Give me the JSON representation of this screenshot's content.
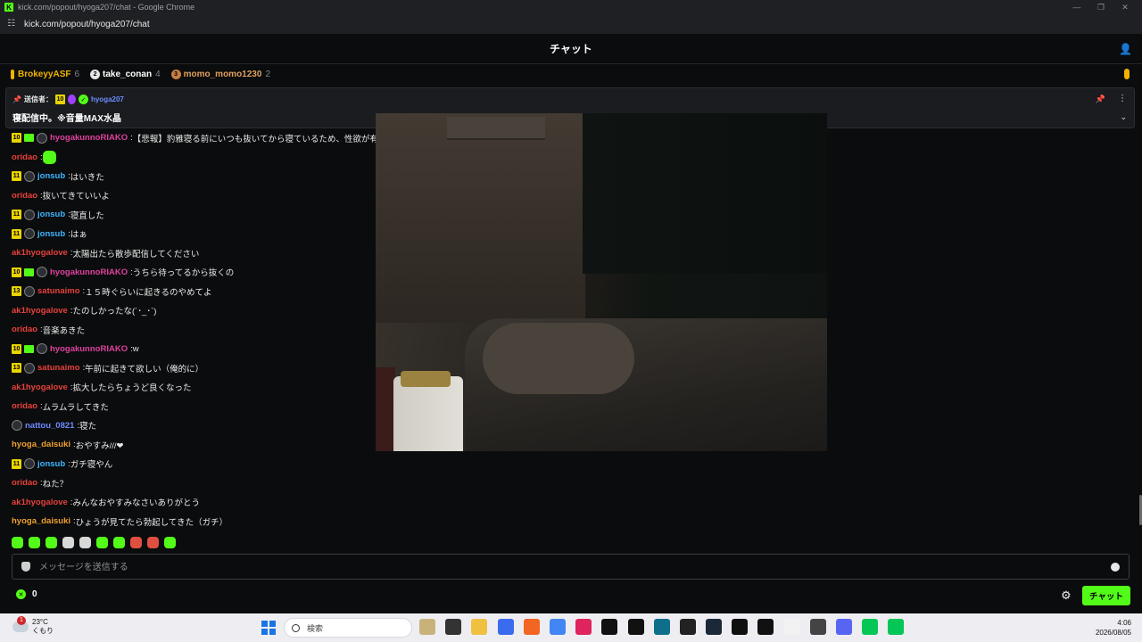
{
  "window": {
    "title": "kick.com/popout/hyoga207/chat - Google Chrome",
    "url": "kick.com/popout/hyoga207/chat"
  },
  "header": {
    "title": "チャット"
  },
  "leaderboard": [
    {
      "name": "BrokeyyASF",
      "count": "6",
      "color": "#f0b400"
    },
    {
      "name": "take_conan",
      "count": "4",
      "medal": "2",
      "color": "#ffffff"
    },
    {
      "name": "momo_momo1230",
      "count": "2",
      "medal": "3",
      "color": "#e0a060"
    }
  ],
  "pinned": {
    "label": "送信者：",
    "badge": "10",
    "user": "hyoga207",
    "text": "寝配信中。※音量MAX水晶"
  },
  "messages": [
    {
      "badges": [
        "10",
        "green",
        "av"
      ],
      "user": "hyogakunnoRIAKO",
      "color": "#e040a0",
      "text": "【悲報】豹雅寝る前にいつも抜いてから寝ているため、性欲が有"
    },
    {
      "badges": [],
      "user": "oridao",
      "color": "#e8413c",
      "text": "",
      "emote": true
    },
    {
      "badges": [
        "11",
        "av"
      ],
      "user": "jonsub",
      "color": "#3fb5ff",
      "text": "はいきた"
    },
    {
      "badges": [],
      "user": "oridao",
      "color": "#e8413c",
      "text": "抜いてきていいよ"
    },
    {
      "badges": [
        "11",
        "av"
      ],
      "user": "jonsub",
      "color": "#3fb5ff",
      "text": "寝直した"
    },
    {
      "badges": [
        "11",
        "av"
      ],
      "user": "jonsub",
      "color": "#3fb5ff",
      "text": "はぁ"
    },
    {
      "badges": [],
      "user": "ak1hyogalove",
      "color": "#e8413c",
      "text": "太陽出たら散歩配信してください"
    },
    {
      "badges": [
        "10",
        "green",
        "av"
      ],
      "user": "hyogakunnoRIAKO",
      "color": "#e040a0",
      "text": "うちら待ってるから抜くの"
    },
    {
      "badges": [
        "13",
        "av"
      ],
      "user": "satunaimo",
      "color": "#e8413c",
      "text": "１５時ぐらいに起きるのやめてよ"
    },
    {
      "badges": [],
      "user": "ak1hyogalove",
      "color": "#e8413c",
      "text": "たのしかったな(´･_･`)"
    },
    {
      "badges": [],
      "user": "oridao",
      "color": "#e8413c",
      "text": "音楽あきた"
    },
    {
      "badges": [
        "10",
        "green",
        "av"
      ],
      "user": "hyogakunnoRIAKO",
      "color": "#e040a0",
      "text": "w"
    },
    {
      "badges": [
        "13",
        "av"
      ],
      "user": "satunaimo",
      "color": "#e8413c",
      "text": "午前に起きて欲しい（俺的に）"
    },
    {
      "badges": [],
      "user": "ak1hyogalove",
      "color": "#e8413c",
      "text": "拡大したらちょうど良くなった"
    },
    {
      "badges": [],
      "user": "oridao",
      "color": "#e8413c",
      "text": "ムラムラしてきた"
    },
    {
      "badges": [
        "av"
      ],
      "user": "nattou_0821",
      "color": "#6c8cff",
      "text": "寝た"
    },
    {
      "badges": [],
      "user": "hyoga_daisuki",
      "color": "#f0a030",
      "text": "おやすみ///❤"
    },
    {
      "badges": [
        "11",
        "av"
      ],
      "user": "jonsub",
      "color": "#3fb5ff",
      "text": "ガチ寝やん"
    },
    {
      "badges": [],
      "user": "oridao",
      "color": "#e8413c",
      "text": "ねた？"
    },
    {
      "badges": [],
      "user": "ak1hyogalove",
      "color": "#e8413c",
      "text": "みんなおやすみなさいありがとう"
    },
    {
      "badges": [],
      "user": "hyoga_daisuki",
      "color": "#f0a030",
      "text": "ひょうが見てたら勃起してきた（ガチ）"
    }
  ],
  "emote_count": 10,
  "input": {
    "placeholder": "メッセージを送信する"
  },
  "footer": {
    "points": "0",
    "send_label": "チャット"
  },
  "taskbar": {
    "temp": "23°C",
    "weather": "くもり",
    "search": "検索",
    "time": "4:06",
    "date": "2026/08/05",
    "notification": "1"
  },
  "colors": {
    "accent": "#53fc18",
    "bg": "#0b0c0d"
  }
}
